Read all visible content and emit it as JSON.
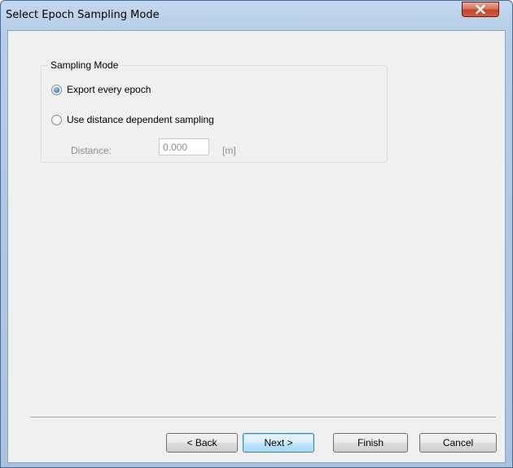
{
  "window": {
    "title": "Select Epoch Sampling Mode"
  },
  "sampling": {
    "group_label": "Sampling Mode",
    "options": [
      {
        "label": "Export every epoch",
        "selected": true
      },
      {
        "label": "Use distance dependent sampling",
        "selected": false
      }
    ],
    "distance_label": "Distance:",
    "distance_value": "0.000",
    "distance_unit": "[m]"
  },
  "buttons": {
    "back": "< Back",
    "next": "Next >",
    "finish": "Finish",
    "cancel": "Cancel"
  },
  "icons": {
    "close": "close-icon"
  },
  "colors": {
    "close_button": "#c3442a",
    "radio_selected": "#3b8ed6",
    "disabled_text": "#8c8c8c"
  }
}
